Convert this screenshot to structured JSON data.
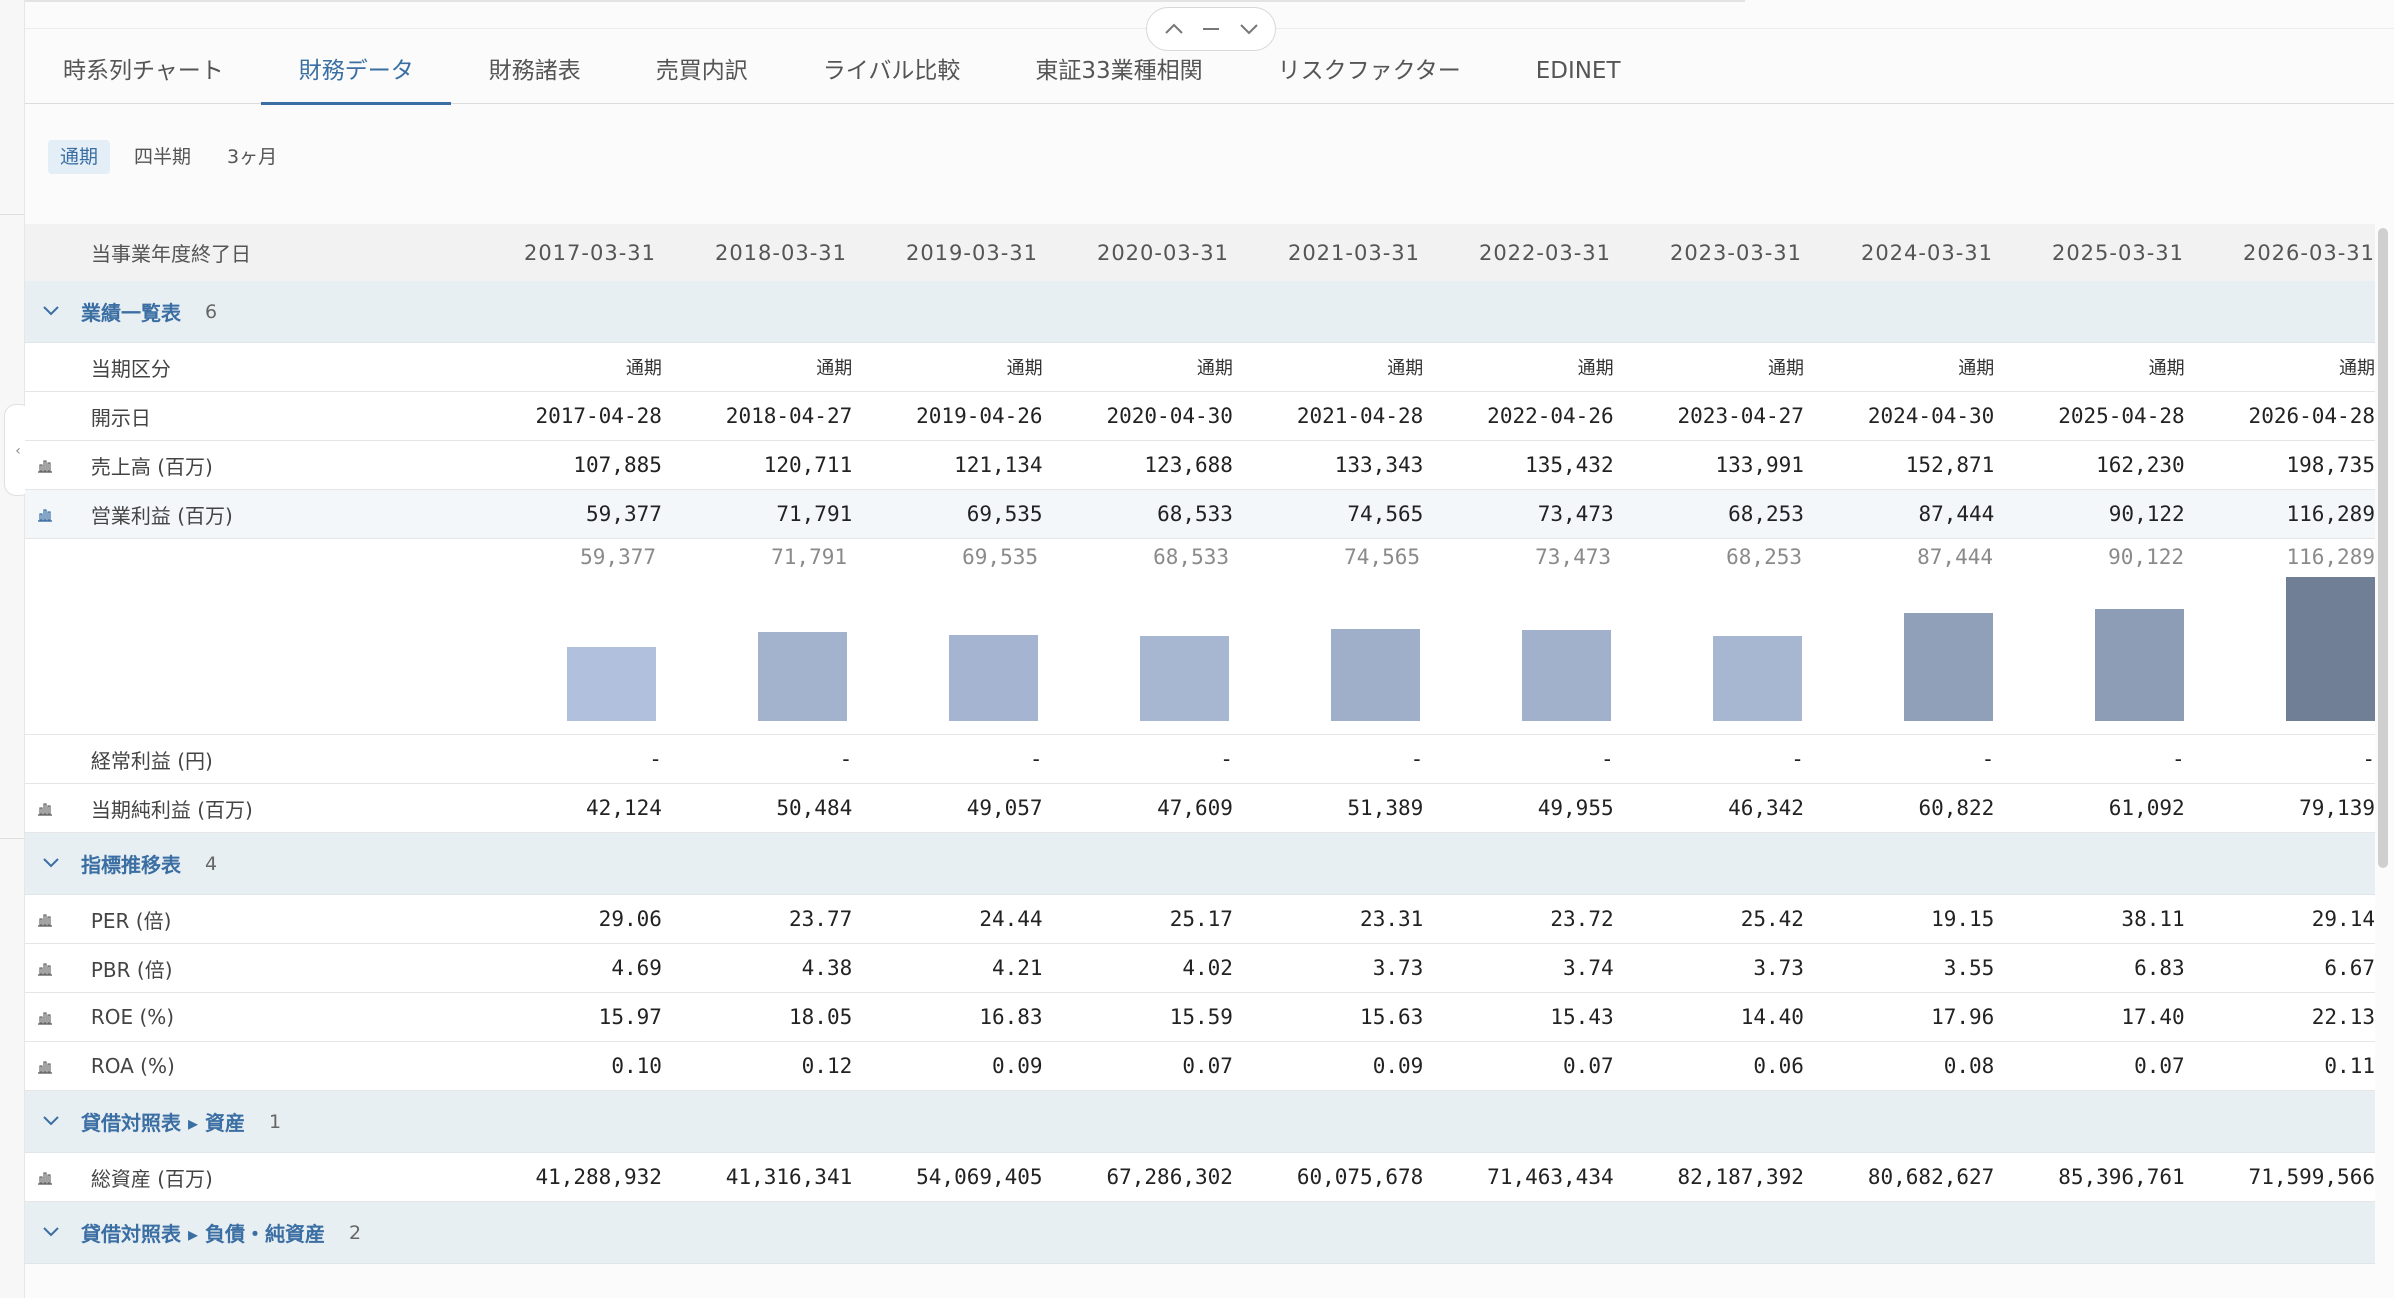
{
  "nav": {
    "tabs": [
      "時系列チャート",
      "財務データ",
      "財務諸表",
      "売買内訳",
      "ライバル比較",
      "東証33業種相関",
      "リスクファクター",
      "EDINET"
    ],
    "active_tab": 1
  },
  "period_tabs": {
    "items": [
      "通期",
      "四半期",
      "3ヶ月"
    ],
    "active": 0
  },
  "table": {
    "header_label": "当事業年度終了日",
    "years": [
      "2017-03-31",
      "2018-03-31",
      "2019-03-31",
      "2020-03-31",
      "2021-03-31",
      "2022-03-31",
      "2023-03-31",
      "2024-03-31",
      "2025-03-31",
      "2026-03-31"
    ],
    "groups": {
      "g1": {
        "title": "業績一覧表",
        "count": "6"
      },
      "g2": {
        "title": "指標推移表",
        "count": "4"
      },
      "g3": {
        "title": "貸借対照表 ▸ 資産",
        "count": "1"
      },
      "g4": {
        "title": "貸借対照表 ▸ 負債・純資産",
        "count": "2"
      }
    },
    "rows": {
      "kubun": {
        "label": "当期区分",
        "values": [
          "通期",
          "通期",
          "通期",
          "通期",
          "通期",
          "通期",
          "通期",
          "通期",
          "通期",
          "通期"
        ]
      },
      "kaiji": {
        "label": "開示日",
        "values": [
          "2017-04-28",
          "2018-04-27",
          "2019-04-26",
          "2020-04-30",
          "2021-04-28",
          "2022-04-26",
          "2023-04-27",
          "2024-04-30",
          "2025-04-28",
          "2026-04-28"
        ]
      },
      "uriage": {
        "label": "売上高 (百万)",
        "values": [
          "107,885",
          "120,711",
          "121,134",
          "123,688",
          "133,343",
          "135,432",
          "133,991",
          "152,871",
          "162,230",
          "198,735"
        ]
      },
      "eigyo": {
        "label": "営業利益 (百万)",
        "values": [
          "59,377",
          "71,791",
          "69,535",
          "68,533",
          "74,565",
          "73,473",
          "68,253",
          "87,444",
          "90,122",
          "116,289"
        ]
      },
      "keijo": {
        "label": "経常利益 (円)",
        "values": [
          "-",
          "-",
          "-",
          "-",
          "-",
          "-",
          "-",
          "-",
          "-",
          "-"
        ]
      },
      "junri": {
        "label": "当期純利益 (百万)",
        "values": [
          "42,124",
          "50,484",
          "49,057",
          "47,609",
          "51,389",
          "49,955",
          "46,342",
          "60,822",
          "61,092",
          "79,139"
        ]
      },
      "per": {
        "label": "PER (倍)",
        "values": [
          "29.06",
          "23.77",
          "24.44",
          "25.17",
          "23.31",
          "23.72",
          "25.42",
          "19.15",
          "38.11",
          "29.14"
        ]
      },
      "pbr": {
        "label": "PBR (倍)",
        "values": [
          "4.69",
          "4.38",
          "4.21",
          "4.02",
          "3.73",
          "3.74",
          "3.73",
          "3.55",
          "6.83",
          "6.67"
        ]
      },
      "roe": {
        "label": "ROE (%)",
        "values": [
          "15.97",
          "18.05",
          "16.83",
          "15.59",
          "15.63",
          "15.43",
          "14.40",
          "17.96",
          "17.40",
          "22.13"
        ]
      },
      "roa": {
        "label": "ROA (%)",
        "values": [
          "0.10",
          "0.12",
          "0.09",
          "0.07",
          "0.09",
          "0.07",
          "0.06",
          "0.08",
          "0.07",
          "0.11"
        ]
      },
      "soshisan": {
        "label": "総資産 (百万)",
        "values": [
          "41,288,932",
          "41,316,341",
          "54,069,405",
          "67,286,302",
          "60,075,678",
          "71,463,434",
          "82,187,392",
          "80,682,627",
          "85,396,761",
          "71,599,566"
        ]
      }
    }
  },
  "chart_data": {
    "type": "bar",
    "categories": [
      "2017-03-31",
      "2018-03-31",
      "2019-03-31",
      "2020-03-31",
      "2021-03-31",
      "2022-03-31",
      "2023-03-31",
      "2024-03-31",
      "2025-03-31",
      "2026-03-31"
    ],
    "values": [
      59377,
      71791,
      69535,
      68533,
      74565,
      73473,
      68253,
      87444,
      90122,
      116289
    ],
    "data_labels": [
      "59,377",
      "71,791",
      "69,535",
      "68,533",
      "74,565",
      "73,473",
      "68,253",
      "87,444",
      "90,122",
      "116,289"
    ],
    "title": "",
    "ylim": [
      0,
      116289
    ],
    "color_range": [
      "#b1c0dc",
      "#707f96"
    ]
  }
}
